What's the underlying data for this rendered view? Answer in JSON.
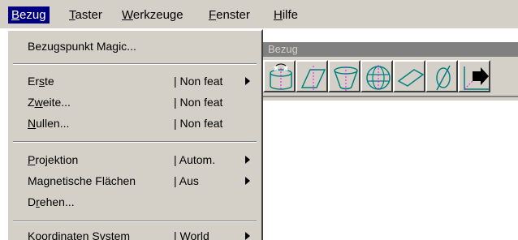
{
  "menubar": {
    "items": [
      {
        "label": "Bezug",
        "mnemonic": "B",
        "rest": "ezug"
      },
      {
        "label": "Taster",
        "mnemonic": "T",
        "rest": "aster"
      },
      {
        "label": "Werkzeuge",
        "mnemonic": "W",
        "rest": "erkzeuge"
      },
      {
        "label": "Fenster",
        "mnemonic": "F",
        "rest": "enster"
      },
      {
        "label": "Hilfe",
        "mnemonic": "H",
        "rest": "ilfe"
      }
    ]
  },
  "toolbar": {
    "title": "Bezug",
    "icons": [
      "cylinder-magic-icon",
      "plane-icon",
      "cone-icon",
      "sphere-icon",
      "flat-plane-icon",
      "phi-angle-icon",
      "coordinate-arrow-icon"
    ]
  },
  "menu": {
    "bezugspunkt_magic": "Bezugspunkt Magic...",
    "erste": {
      "pre": "Er",
      "mn": "s",
      "post": "te",
      "value": "| Non feat"
    },
    "zweite": {
      "pre": "Z",
      "mn": "w",
      "post": "eite...",
      "value": "| Non feat"
    },
    "nullen": {
      "pre": "",
      "mn": "N",
      "post": "ullen...",
      "value": "| Non feat"
    },
    "projektion": {
      "pre": "",
      "mn": "P",
      "post": "rojektion",
      "value": "| Autom."
    },
    "magnetische": {
      "pre": "Ma",
      "mn": "g",
      "post": "netische Flächen",
      "value": "| Aus"
    },
    "drehen": {
      "pre": "D",
      "mn": "r",
      "post": "ehen...",
      "value": ""
    },
    "koordinaten": {
      "pre": "",
      "mn": "K",
      "post": "oordinaten System",
      "value": "| World"
    }
  },
  "colors": {
    "menu_bg": "#d4d0c8",
    "highlight": "#000080",
    "title_bar": "#808080"
  }
}
